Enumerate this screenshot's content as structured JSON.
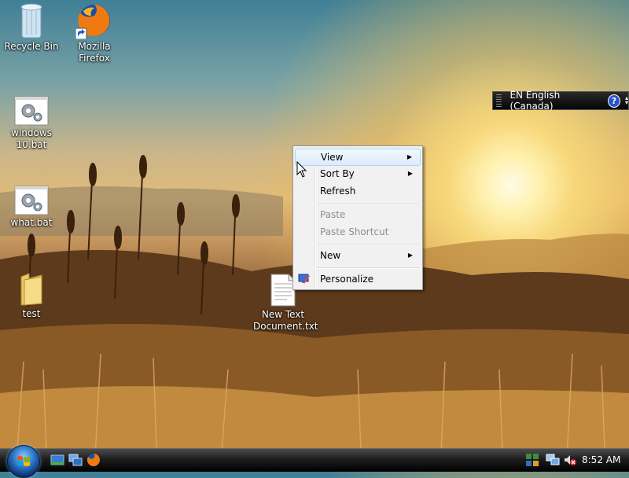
{
  "desktop": {
    "icons": [
      {
        "label": "Recycle Bin"
      },
      {
        "label": "Mozilla Firefox"
      },
      {
        "label": "windows 10.bat"
      },
      {
        "label": "what.bat"
      },
      {
        "label": "test"
      },
      {
        "label": "New Text Document.txt"
      }
    ]
  },
  "language_bar": {
    "text": "EN English (Canada)",
    "help": "?"
  },
  "context_menu": {
    "items": [
      {
        "label": "View",
        "submenu": true,
        "enabled": true
      },
      {
        "label": "Sort By",
        "submenu": true,
        "enabled": true
      },
      {
        "label": "Refresh",
        "submenu": false,
        "enabled": true
      },
      {
        "label": "Paste",
        "submenu": false,
        "enabled": false
      },
      {
        "label": "Paste Shortcut",
        "submenu": false,
        "enabled": false
      },
      {
        "label": "New",
        "submenu": true,
        "enabled": true
      },
      {
        "label": "Personalize",
        "submenu": false,
        "enabled": true
      }
    ],
    "arrow_glyph": "▶"
  },
  "taskbar": {
    "clock": "8:52 AM"
  },
  "colors": {
    "menu_highlight": "#dcebfb",
    "taskbar": "#1d1d1d",
    "start_orb": "#2d78c8"
  }
}
